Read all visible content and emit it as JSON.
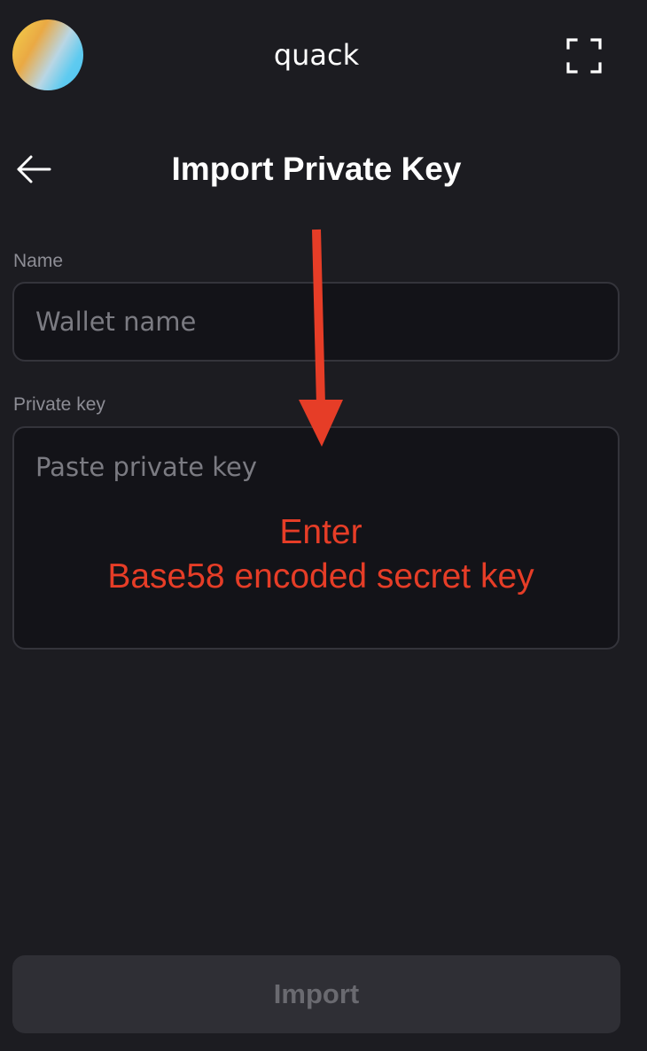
{
  "topbar": {
    "account_name": "quack",
    "avatar_icon": "account-avatar-gradient",
    "expand_icon": "fullscreen-expand-icon"
  },
  "header": {
    "back_icon": "arrow-left-icon",
    "title": "Import Private Key"
  },
  "form": {
    "name_label": "Name",
    "name_placeholder": "Wallet name",
    "name_value": "",
    "key_label": "Private key",
    "key_placeholder": "Paste private key",
    "key_value": ""
  },
  "annotation": {
    "line1": "Enter",
    "line2": "Base58 encoded secret key",
    "color": "#e63d27"
  },
  "footer": {
    "import_label": "Import"
  },
  "colors": {
    "background": "#1c1c21",
    "input_background": "#131318",
    "input_border": "#34343b",
    "button_disabled_bg": "#2f2f35",
    "button_disabled_text": "#6a6a70"
  }
}
